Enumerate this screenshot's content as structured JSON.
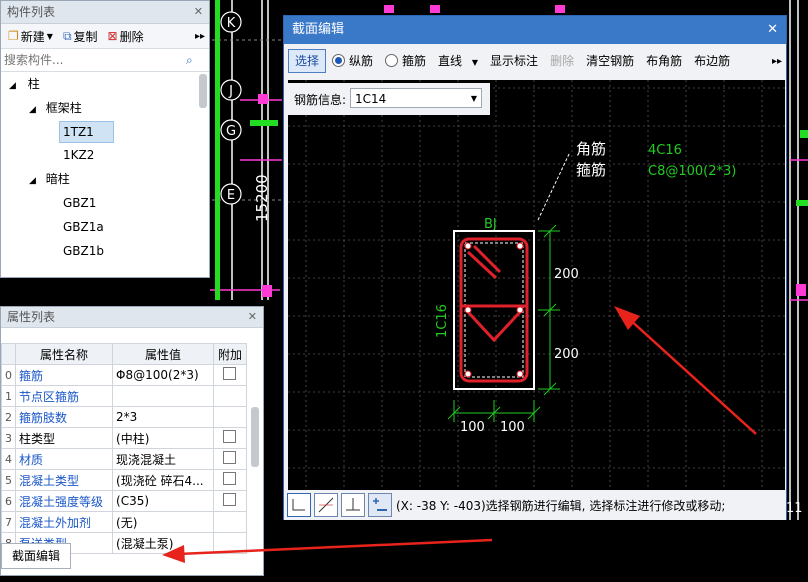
{
  "cad_bg": {
    "axis_labels": [
      "K",
      "J",
      "G",
      "E"
    ],
    "dimension": "15200",
    "right_number": "11"
  },
  "component_panel": {
    "title": "构件列表",
    "new_label": "新建",
    "copy_label": "复制",
    "delete_label": "删除",
    "search_placeholder": "搜索构件...",
    "tree": {
      "root": "柱",
      "group1": "框架柱",
      "items1": [
        "1TZ1",
        "1KZ2"
      ],
      "group2": "暗柱",
      "items2": [
        "GBZ1",
        "GBZ1a",
        "GBZ1b"
      ]
    }
  },
  "attr_panel": {
    "title": "属性列表",
    "headers": [
      "属性名称",
      "属性值",
      "附加"
    ],
    "rows": [
      {
        "idx": "0",
        "name": "箍筋",
        "value": "Φ8@100(2*3)",
        "blue": true,
        "check": true
      },
      {
        "idx": "1",
        "name": "节点区箍筋",
        "value": "",
        "blue": true,
        "check": false
      },
      {
        "idx": "2",
        "name": "箍筋肢数",
        "value": "2*3",
        "blue": true,
        "check": false
      },
      {
        "idx": "3",
        "name": "柱类型",
        "value": "(中柱)",
        "blue": false,
        "check": true
      },
      {
        "idx": "4",
        "name": "材质",
        "value": "现浇混凝土",
        "blue": true,
        "check": true
      },
      {
        "idx": "5",
        "name": "混凝土类型",
        "value": "(现浇砼 碎石4...",
        "blue": true,
        "check": true
      },
      {
        "idx": "6",
        "name": "混凝土强度等级",
        "value": "(C35)",
        "blue": true,
        "check": true
      },
      {
        "idx": "7",
        "name": "混凝土外加剂",
        "value": "(无)",
        "blue": true,
        "check": false
      },
      {
        "idx": "8",
        "name": "泵送类型",
        "value": "(混凝土泵)",
        "blue": true,
        "check": false
      }
    ],
    "section_edit_button": "截面编辑"
  },
  "dialog": {
    "title": "截面编辑",
    "toolbar": {
      "select": "选择",
      "longitudinal": "纵筋",
      "stirrup": "箍筋",
      "line_mode": "直线",
      "show_labels": "显示标注",
      "delete": "删除",
      "clear_rebar": "清空钢筋",
      "corner_rebar": "布角筋",
      "side_rebar": "布边筋"
    },
    "rebar_info_label": "钢筋信息:",
    "rebar_info_value": "1C14",
    "drawing": {
      "corner_label": "角筋",
      "stirrup_label": "箍筋",
      "corner_value": "4C16",
      "stirrup_value": "C8@100(2*3)",
      "bj": "BJ",
      "side": "1C16",
      "dim_v1": "200",
      "dim_v2": "200",
      "dim_h1": "100",
      "dim_h2": "100"
    },
    "status": "(X: -38 Y: -403)选择钢筋进行编辑, 选择标注进行修改或移动;"
  },
  "colors": {
    "rebar_red": "#e0202a",
    "dim_green": "#22cc22",
    "title_blue": "#3a78c8",
    "arrow_red": "#e8231c"
  }
}
